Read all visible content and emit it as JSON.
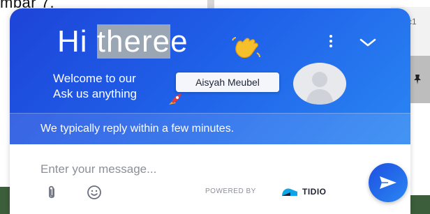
{
  "background": {
    "top_text": "mbar 7.",
    "right_code": "c1"
  },
  "widget": {
    "greeting_prefix": "Hi ",
    "greeting_selected": "there",
    "greeting_suffix": "e",
    "greeting_icon": "waving-hand-icon",
    "welcome_line1": "Welcome to our",
    "welcome_line2": "Ask us anything",
    "welcome_icon": "rocket-icon",
    "tooltip": "Aisyah Meubel",
    "reply_time": "We typically reply within a few minutes.",
    "input_placeholder": "Enter your message...",
    "powered_by": "POWERED BY",
    "brand": "TIDIO"
  },
  "colors": {
    "header_start": "#1e44d8",
    "header_end": "#2a86f3",
    "text_dark": "#1e2433",
    "placeholder": "#8b8f98"
  }
}
